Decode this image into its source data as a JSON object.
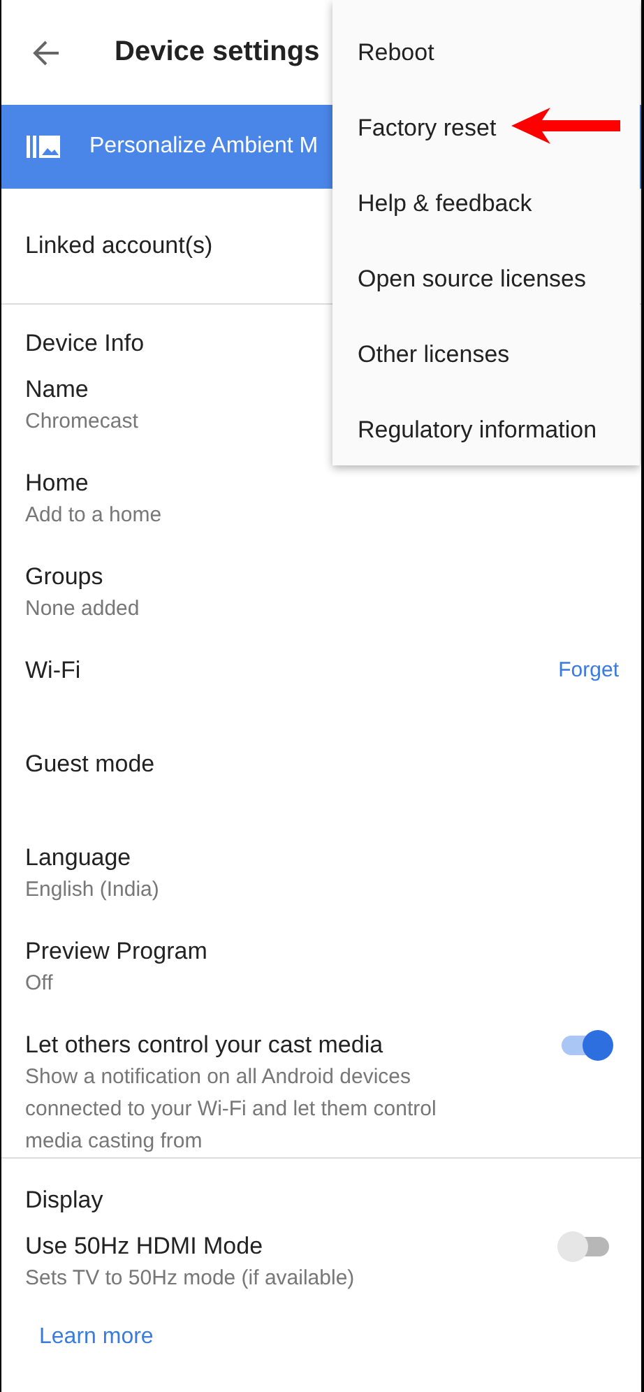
{
  "header": {
    "title": "Device settings"
  },
  "banner": {
    "label": "Personalize Ambient M"
  },
  "linked": {
    "label": "Linked account(s)"
  },
  "sections": [
    {
      "title": "Device Info",
      "rows": [
        {
          "kind": "text",
          "label": "Name",
          "value": "Chromecast"
        },
        {
          "kind": "text",
          "label": "Home",
          "value": "Add to a home"
        },
        {
          "kind": "text",
          "label": "Groups",
          "value": "None added"
        },
        {
          "kind": "action",
          "label": "Wi-Fi",
          "action": "Forget"
        },
        {
          "kind": "text",
          "label": "Guest mode"
        },
        {
          "kind": "text",
          "label": "Language",
          "value": "English (India)"
        },
        {
          "kind": "text",
          "label": "Preview Program",
          "value": "Off"
        },
        {
          "kind": "toggle",
          "label": "Let others control your cast media",
          "value": "Show a notification on all Android devices connected to your Wi-Fi and let them control media casting from",
          "on": true
        }
      ]
    },
    {
      "title": "Display",
      "rows": [
        {
          "kind": "toggle",
          "label": "Use 50Hz HDMI Mode",
          "value": "Sets TV to 50Hz mode (if available)",
          "on": false
        }
      ],
      "link": "Learn more"
    }
  ],
  "menu": {
    "items": [
      {
        "label": "Reboot",
        "arrow": false
      },
      {
        "label": "Factory reset",
        "arrow": true
      },
      {
        "label": "Help & feedback",
        "arrow": false
      },
      {
        "label": "Open source licenses",
        "arrow": false
      },
      {
        "label": "Other licenses",
        "arrow": false
      },
      {
        "label": "Regulatory information",
        "arrow": false
      }
    ]
  }
}
